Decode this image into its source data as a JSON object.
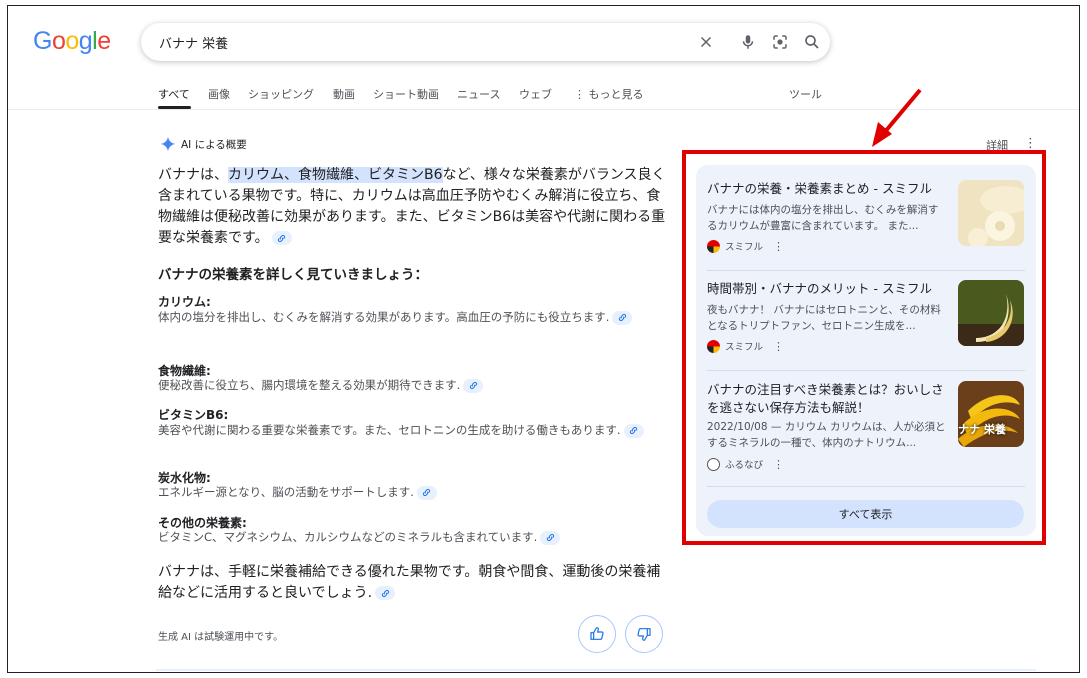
{
  "header": {
    "logo_letters": [
      "G",
      "o",
      "o",
      "g",
      "l",
      "e"
    ],
    "logo_colors": [
      "#4285f4",
      "#ea4335",
      "#fbbc05",
      "#4285f4",
      "#34a853",
      "#ea4335"
    ],
    "search_query": "バナナ 栄養",
    "icons": [
      "close-icon",
      "microphone-icon",
      "lens-camera-icon",
      "search-icon"
    ]
  },
  "tabs": {
    "items": [
      "すべて",
      "画像",
      "ショッピング",
      "動画",
      "ショート動画",
      "ニュース",
      "ウェブ",
      "⋮ もっと見る",
      "ツール"
    ],
    "active_index": 0
  },
  "ai_overview": {
    "heading": "AI による概要",
    "detail_label": "詳細",
    "intro_pre": "バナナは、",
    "intro_highlight": "カリウム、食物繊維、ビタミンB6",
    "intro_post": "など、様々な栄養素がバランス良く含まれている果物です。特に、カリウムは高血圧予防やむくみ解消に役立ち、食物繊維は便秘改善に効果があります。また、ビタミンB6は美容や代謝に関わる重要な栄養素です。",
    "subheading": "バナナの栄養素を詳しく見ていきましょう：",
    "items": [
      {
        "title": "カリウム:",
        "body": "体内の塩分を排出し、むくみを解消する効果があります。高血圧の予防にも役立ちます."
      },
      {
        "title": "食物繊維:",
        "body": "便秘改善に役立ち、腸内環境を整える効果が期待できます."
      },
      {
        "title": "ビタミンB6:",
        "body": "美容や代謝に関わる重要な栄養素です。また、セロトニンの生成を助ける働きもあります."
      },
      {
        "title": "炭水化物:",
        "body": "エネルギー源となり、脳の活動をサポートします."
      },
      {
        "title": "その他の栄養素:",
        "body": "ビタミンC、マグネシウム、カルシウムなどのミネラルも含まれています."
      }
    ],
    "outro": "バナナは、手軽に栄養補給できる優れた果物です。朝食や間食、運動後の栄養補給などに活用すると良いでしょう.",
    "footer_note": "生成 AI は試験運用中です。"
  },
  "sources": {
    "items": [
      {
        "title": "バナナの栄養・栄養素まとめ - スミフル",
        "snippet": "バナナには体内の塩分を排出し、むくみを解消するカリウムが豊富に含まれています。 また...",
        "site": "スミフル"
      },
      {
        "title": "時間帯別・バナナのメリット - スミフル",
        "snippet": "夜もバナナ！ バナナにはセロトニンと、その材料となるトリプトファン、セロトニン生成を...",
        "site": "スミフル"
      },
      {
        "title": "バナナの注目すべき栄養素とは？おいしさを逃さない保存方法も解説！",
        "snippet": "2022/10/08 — カリウム カリウムは、人が必須とするミネラルの一種で、体内のナトリウム...",
        "site": "ふるなび",
        "image_text": "ナナ 栄養"
      }
    ],
    "show_all_label": "すべて表示"
  },
  "annotation": {
    "color": "#e00000"
  }
}
